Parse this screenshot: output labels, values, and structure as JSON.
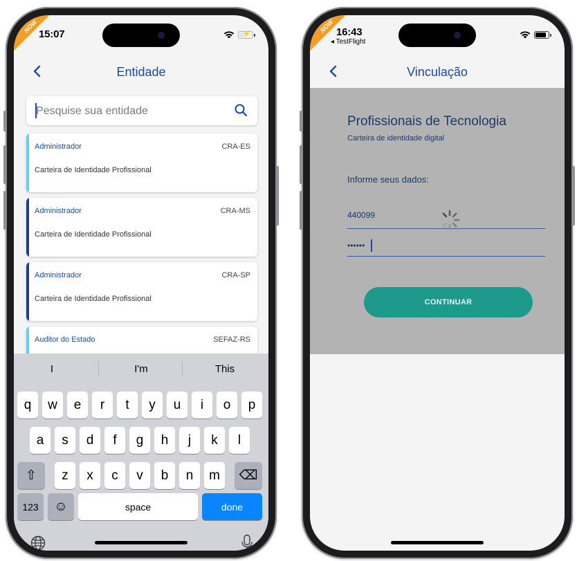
{
  "phone1": {
    "ribbon": "NOW",
    "time": "15:07",
    "nav_title": "Entidade",
    "search_placeholder": "Pesquise sua entidade",
    "cards": [
      {
        "role": "Administrador",
        "code": "CRA-ES",
        "desc": "Carteira de Identidade Profissional",
        "accent": "#5ed3f0"
      },
      {
        "role": "Administrador",
        "code": "CRA-MS",
        "desc": "Carteira de Identidade Profissional",
        "accent": "#1b3f8c"
      },
      {
        "role": "Administrador",
        "code": "CRA-SP",
        "desc": "Carteira de Identidade Profissional",
        "accent": "#1b3f8c"
      },
      {
        "role": "Auditor do Estado",
        "code": "SEFAZ-RS",
        "desc": "",
        "accent": "#5ed3f0"
      }
    ],
    "keyboard": {
      "suggestions": [
        "I",
        "I'm",
        "This"
      ],
      "row1": [
        "q",
        "w",
        "e",
        "r",
        "t",
        "y",
        "u",
        "i",
        "o",
        "p"
      ],
      "row2": [
        "a",
        "s",
        "d",
        "f",
        "g",
        "h",
        "j",
        "k",
        "l"
      ],
      "row3": [
        "z",
        "x",
        "c",
        "v",
        "b",
        "n",
        "m"
      ],
      "numbers_label": "123",
      "space_label": "space",
      "done_label": "done",
      "shift_icon": "⇧",
      "delete_icon": "⌫",
      "emoji_icon": "☺",
      "globe_icon": "globe",
      "mic_icon": "mic"
    }
  },
  "phone2": {
    "ribbon": "NOW",
    "time": "16:43",
    "back_app": "◂ TestFlight",
    "nav_title": "Vinculação",
    "heading": "Profissionais de Tecnologia",
    "subheading": "Carteira de identidade digital",
    "form_label": "Informe seus dados:",
    "field1_value": "440099",
    "field2_value": "••••••",
    "continue_label": "CONTINUAR"
  },
  "colors": {
    "nav_blue": "#1b4a9c",
    "continue_teal": "#1d9a8c",
    "keyboard_bg": "#d1d3d9",
    "done_blue": "#0a84ff",
    "overlay_gray": "#b3b3b3"
  }
}
